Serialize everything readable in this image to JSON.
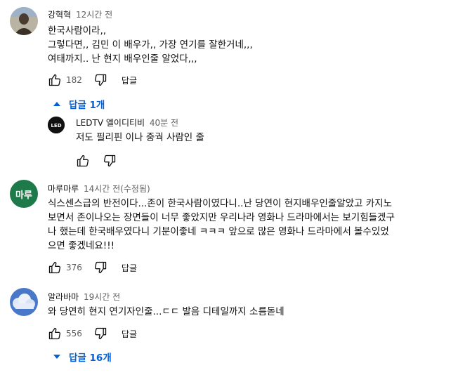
{
  "comments": [
    {
      "author": "강혁혁",
      "time": "12시간 전",
      "lines": [
        "한국사람이라,,",
        "그렇다면,, 김민 이 배우가,, 가장 연기를 잘한거네,,,",
        "여태까지.. 난 현지 배우인줄 알었다,,,"
      ],
      "likes": "182",
      "reply_label": "답글",
      "replies_toggle": "답글 1개",
      "replies": [
        {
          "author": "LEDTV 엘이디티비",
          "time": "40분 전",
          "avatar_text": "LED",
          "lines": [
            "저도 필리핀 이나 중궉 사람인 줄"
          ]
        }
      ]
    },
    {
      "author": "마루마루",
      "time": "14시간 전(수정됨)",
      "avatar_text": "마루",
      "avatar_color": "#1e7a4a",
      "lines": [
        "식스센스급의 반전이다...존이 한국사람이였다니..난 당연이 현지배우인줄알았고 카지노",
        "보면서 존이나오는 장면들이 너무 좋았지만 우리나라 영화나 드라마에서는 보기힘들겠구",
        "나 했는데 한국배우였다니 기분이좋네 ㅋㅋㅋ 앞으로 많은 영화나 드라마에서 볼수있었",
        "으면 좋겠네요!!!"
      ],
      "likes": "376",
      "reply_label": "답글"
    },
    {
      "author": "알라바마",
      "time": "19시간 전",
      "lines": [
        "와 당연히 현지 연기자인줄...ㄷㄷ  발음 디테일까지 소름돋네"
      ],
      "likes": "556",
      "reply_label": "답글",
      "replies_toggle": "답글 16개"
    }
  ],
  "colors": {
    "accent": "#065fd4",
    "secondary_text": "#606060"
  }
}
